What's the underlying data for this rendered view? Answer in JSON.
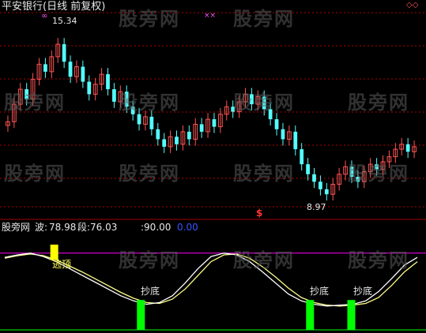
{
  "header": {
    "title": "平安银行(日线 前复权)",
    "marker_left": "∞",
    "marker_mid": "××",
    "marker_right": "◇◇"
  },
  "watermark": "股旁网",
  "colors": {
    "up": "#ff5454",
    "down": "#54ffff",
    "grid": "#b00000",
    "divider": "#a00000",
    "wave1": "#ffffff",
    "wave2": "#ffff88",
    "top_line": "#ff00ff",
    "bottom_line": "#00ff00",
    "top_signal": "#ffff00",
    "bottom_signal": "#00ff00",
    "dollar": "#ff3333"
  },
  "price_chart": {
    "high_label": "15.34",
    "low_label": "8.97",
    "dollar_marker": "$",
    "ylim": [
      8.5,
      16.2
    ]
  },
  "indicator": {
    "name": "股旁网",
    "wave_label": "波:",
    "wave_value": "78.98",
    "segment_label": "段:",
    "segment_value": "76.03",
    "level1": ":90.00",
    "level2": "0.00",
    "ylim": [
      0,
      100
    ],
    "top_level": 90,
    "bottom_level": 0
  },
  "signals": {
    "top": [
      {
        "label": "逃顶",
        "position": 0.12
      }
    ],
    "bottom": [
      {
        "label": "抄底",
        "position": 0.33
      },
      {
        "label": "抄底",
        "position": 0.74
      },
      {
        "label": "抄底",
        "position": 0.84
      }
    ]
  },
  "chart_data": {
    "type": "candlestick",
    "title": "平安银行(日线 前复权)",
    "closes": [
      11.9,
      12.6,
      13.2,
      12.8,
      13.6,
      14.2,
      13.9,
      14.5,
      15.0,
      14.3,
      13.7,
      14.1,
      13.5,
      13.0,
      13.4,
      13.8,
      13.2,
      12.7,
      13.1,
      12.5,
      12.2,
      11.8,
      12.1,
      11.6,
      11.2,
      10.9,
      11.3,
      11.0,
      11.5,
      11.2,
      11.8,
      11.5,
      12.0,
      11.7,
      12.2,
      12.5,
      12.3,
      12.7,
      13.0,
      12.6,
      12.9,
      12.4,
      12.0,
      11.6,
      11.2,
      11.5,
      10.8,
      10.2,
      9.8,
      9.5,
      9.2,
      9.0,
      9.4,
      9.8,
      10.1,
      9.7,
      9.5,
      9.9,
      10.2,
      10.0,
      10.3,
      10.5,
      10.8,
      11.0,
      10.7,
      10.9
    ],
    "wave": [
      85,
      88,
      90,
      86,
      80,
      72,
      64,
      56,
      48,
      40,
      34,
      30,
      32,
      40,
      55,
      72,
      86,
      90,
      88,
      80,
      68,
      55,
      42,
      34,
      30,
      28,
      29,
      30,
      34,
      45,
      60,
      76,
      85
    ],
    "segment": [
      84,
      87,
      89,
      87,
      82,
      75,
      68,
      60,
      52,
      44,
      37,
      32,
      31,
      36,
      48,
      64,
      80,
      88,
      89,
      84,
      74,
      62,
      49,
      38,
      32,
      29,
      28,
      29,
      31,
      38,
      52,
      68,
      80
    ]
  }
}
